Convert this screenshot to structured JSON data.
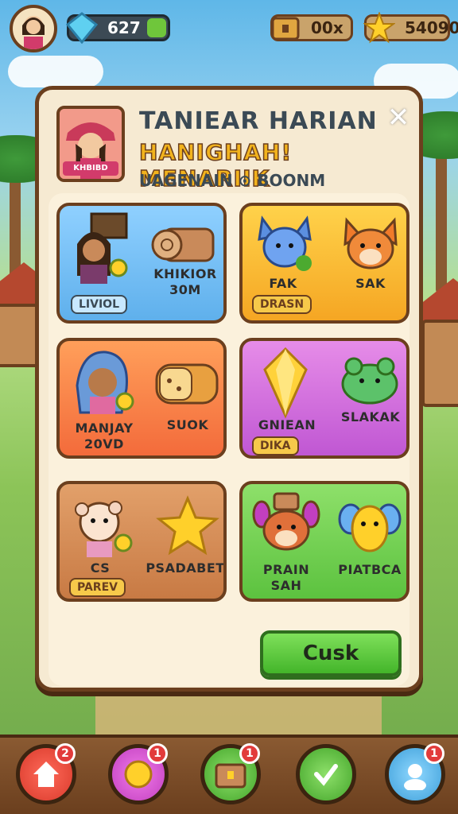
{
  "topbar": {
    "gems_value": "627",
    "coins_value": "00x",
    "stars_value": "54090"
  },
  "modal": {
    "title_line1": "TANIEAR HARIAN",
    "title_line2": "HANIGHAH! MENARIIK",
    "subtitle": "UAGENAIN ⊙ BOONM",
    "portrait_tag": "KHBIBD",
    "close_label": "✕",
    "confirm_label": "Cusk"
  },
  "cards": [
    {
      "label": "KHIKIOR\n30M",
      "badge": "LIVIOL",
      "art_left": "character",
      "art_right": "wood-logs"
    },
    {
      "label_left": "FAK",
      "label_right": "SAK",
      "badge": "DRASN",
      "art_left": "blue-creature",
      "art_right": "fox"
    },
    {
      "label_left": "MANJAY\n20VD",
      "label_right": "SUOK",
      "art_left": "hooded-girl",
      "art_right": "bread"
    },
    {
      "label_left": "GNIEAN",
      "label_right": "SLAKAK",
      "badge": "DIKA",
      "art_left": "gem",
      "art_right": "green-creature"
    },
    {
      "label_left": "CS",
      "label_right": "PSADABET",
      "badge": "PAREV",
      "art_left": "baby-character",
      "art_right": "gold-star"
    },
    {
      "label_left": "PRAIN\nSAH",
      "label_right": "PIATBCA",
      "art_left": "bunny-creature",
      "art_right": "yellow-dragon"
    }
  ],
  "bottom_nav": [
    {
      "name": "home",
      "badge": "2"
    },
    {
      "name": "coin",
      "badge": "1"
    },
    {
      "name": "chest",
      "badge": "1"
    },
    {
      "name": "check",
      "badge": ""
    },
    {
      "name": "profile",
      "badge": "1"
    }
  ],
  "colors": {
    "frame_brown": "#6b3f1e",
    "cream": "#f6ead2",
    "title_yellow": "#f2b31d",
    "confirm_green": "#43b52a"
  }
}
